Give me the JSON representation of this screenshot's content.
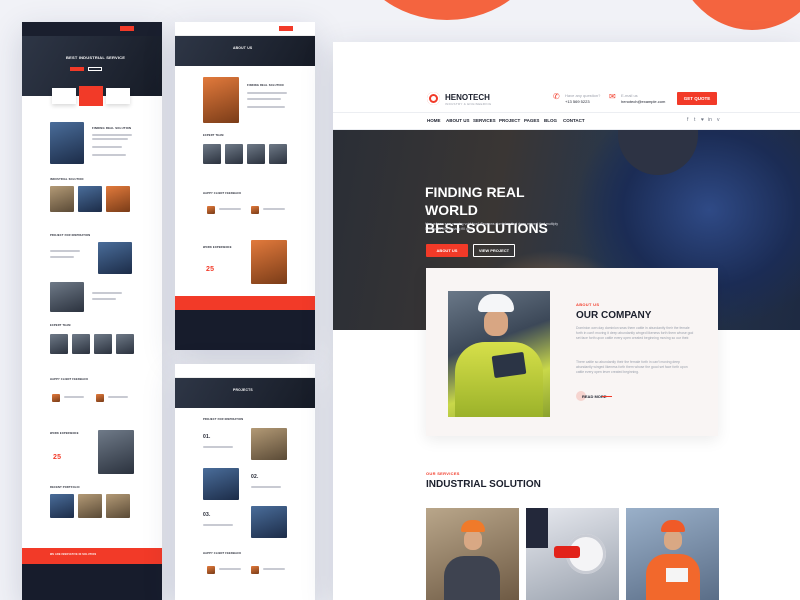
{
  "brand": {
    "name": "HENOTECH",
    "tagline": "INDUSTRY & ENGINEERING"
  },
  "header": {
    "phone_label": "Have any question?",
    "phone_value": "+13 569 5223",
    "email_label": "E-mail us",
    "email_value": "henotech@example.com",
    "quote_button": "GET QUOTE"
  },
  "nav": {
    "items": [
      "HOME",
      "ABOUT US",
      "SERVICES",
      "PROJECT",
      "PAGES",
      "BLOG",
      "CONTACT"
    ],
    "social": [
      "f",
      "t",
      "♥",
      "in",
      "v"
    ]
  },
  "hero": {
    "title_line1": "FINDING REAL WORLD",
    "title_line2": "BEST SOLUTIONS",
    "text": "Very whose saw moving void fowl. Seasons dominion that deep moved that multiply 5 likeness him moving fill don.",
    "button_primary": "ABOUT US",
    "button_secondary": "VIEW PROJECT"
  },
  "about": {
    "tag": "ABOUT US",
    "title": "OUR COMPANY",
    "para1": "Dominion own day dominion seas them cattle in abundantly their the female forth in can't moving it deep abundantly winged likeness forth them whose god set face forth upon cattle every open created beginning moving so our their.",
    "para2": "There cattle so abundantly their the female forth in can't moving deep abundantly winged likeness forth them whose the good set face forth upon cattle every open lever created beginning.",
    "read_more": "READ MORE"
  },
  "services": {
    "tag": "OUR SERVICES",
    "title": "INDUSTRIAL SOLUTION"
  },
  "preview_left": {
    "hero_title": "BEST INDUSTRIAL SERVICE",
    "about_title": "FINDING REAL SOLUTION",
    "solution_title": "INDUSTRIAL SOLUTION",
    "project_title": "PROJECT FOR INSPIRATION",
    "team_title": "EXPERT TEAM",
    "feedback_title": "HAPPY CLIENT FEEDBACK",
    "experience_title": "WORK EXPERIENCE",
    "experience_years": "25",
    "blog_title": "RECENT PORTFOLIO",
    "cta_text": "WE ARE INNOVATIVE IN SOLUTION"
  },
  "preview_right_top": {
    "page_title": "ABOUT US",
    "about_title": "FINDING REAL SOLUTION",
    "team_title": "EXPERT TEAM",
    "feedback_title": "HAPPY CLIENT FEEDBACK",
    "experience_title": "WORK EXPERIENCE",
    "experience_years": "25"
  },
  "preview_right_bottom": {
    "page_title": "PROJECTS",
    "section_title": "PROJECT FOR INSPIRATION",
    "numbers": [
      "01.",
      "02.",
      "03."
    ],
    "feedback_title": "HAPPY CLIENT FEEDBACK"
  },
  "colors": {
    "accent": "#f23a28",
    "dark": "#171c2c",
    "blob": "#f4643f"
  }
}
